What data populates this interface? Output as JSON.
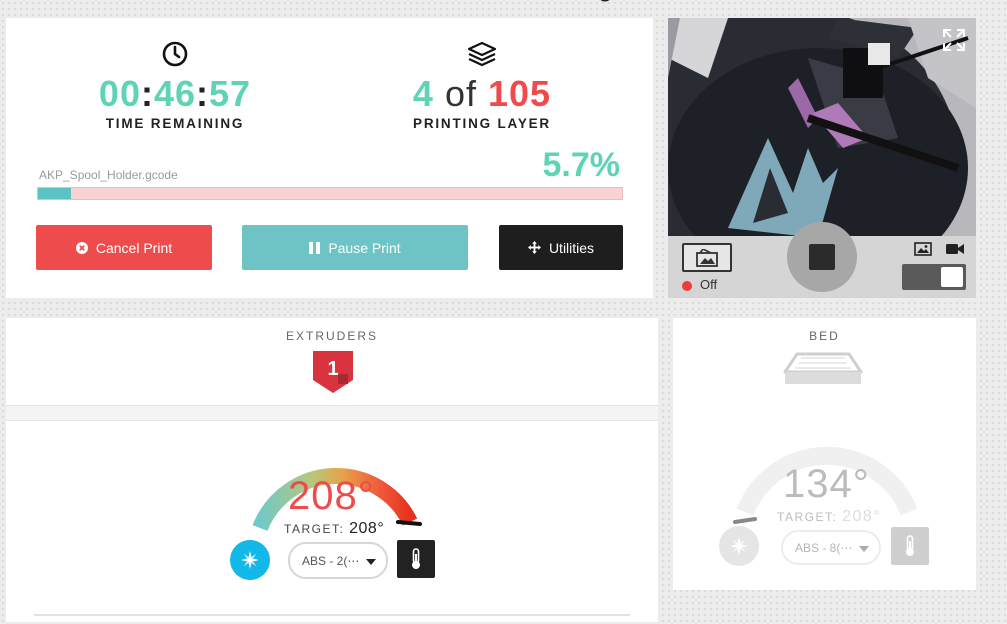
{
  "print": {
    "time_remaining": {
      "hh": "00",
      "mm": "46",
      "ss": "57",
      "sep": ":",
      "label": "TIME REMAINING"
    },
    "layer": {
      "current": "4",
      "of_text": "of",
      "total": "105",
      "label": "PRINTING LAYER"
    },
    "filename": "AKP_Spool_Holder.gcode",
    "percent_text": "5.7%",
    "progress_fraction": 0.057,
    "buttons": {
      "cancel": "Cancel Print",
      "pause": "Pause Print",
      "utilities": "Utilities"
    }
  },
  "webcam": {
    "record_status": "Off",
    "icons": [
      "expand-icon",
      "snapshot-icon",
      "stop-icon",
      "image-mode-icon",
      "video-mode-icon"
    ],
    "toggle_on": true
  },
  "extruders": {
    "title": "EXTRUDERS",
    "badge_number": "1",
    "temperature": "208°",
    "target_label": "TARGET:",
    "target_value": "208°",
    "material_select": "ABS - 2(⋯",
    "gauge_fraction": 1.0
  },
  "bed": {
    "title": "BED",
    "temperature": "134°",
    "target_label": "TARGET:",
    "target_value": "208°",
    "material_select": "ABS - 8(⋯",
    "gauge_fraction": 0.0
  },
  "colors": {
    "accent_teal": "#5fd3b6",
    "accent_red": "#ee4c4c",
    "pause_teal": "#6ec4c4",
    "fan_blue": "#12b9e8"
  }
}
